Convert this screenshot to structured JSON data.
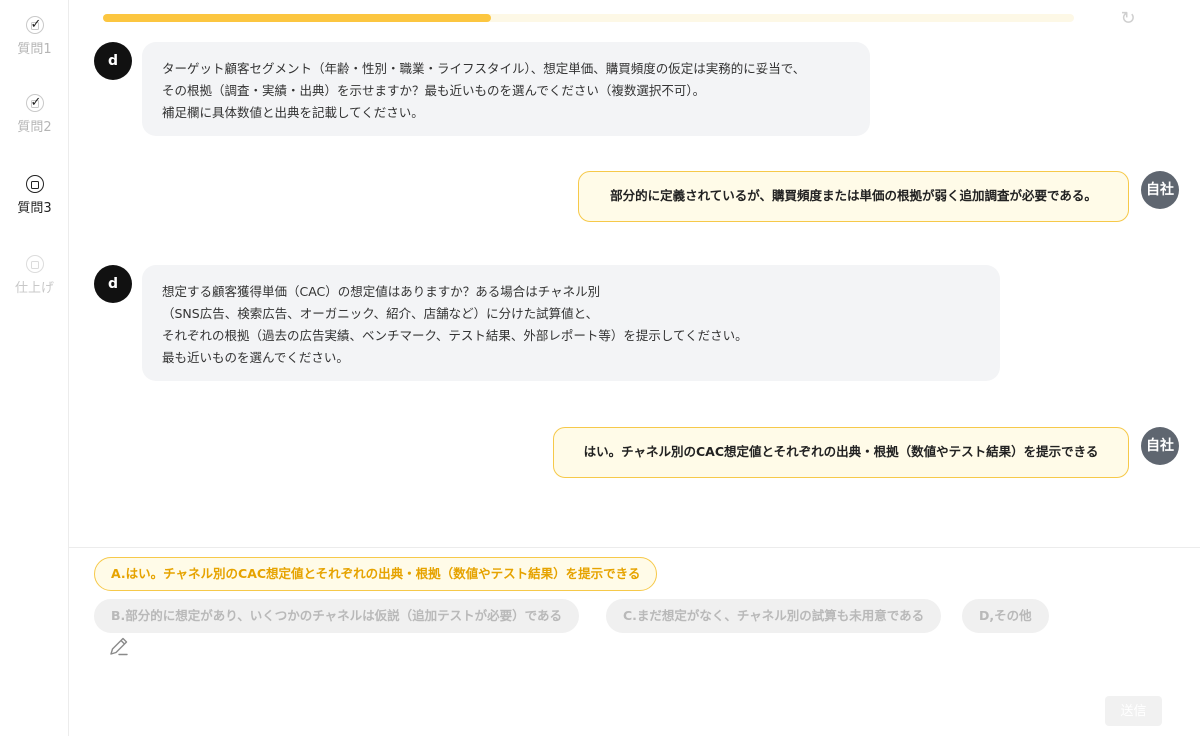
{
  "sidebar": {
    "steps": [
      {
        "label": "質問1",
        "state": "done"
      },
      {
        "label": "質問2",
        "state": "done"
      },
      {
        "label": "質問3",
        "state": "active"
      },
      {
        "label": "仕上げ",
        "state": "future"
      }
    ]
  },
  "progress": {
    "value_percent": 40
  },
  "chat": {
    "bot_avatar": "d",
    "self_avatar": "自社",
    "q1_lines": [
      "ターゲット顧客セグメント（年齢・性別・職業・ライフスタイル）、想定単価、購買頻度の仮定は実務的に妥当で、",
      "その根拠（調査・実績・出典）を示せますか？最も近いものを選んでください（複数選択不可）。",
      "補足欄に具体数値と出典を記載してください。"
    ],
    "a1": "部分的に定義されているが、購買頻度または単価の根拠が弱く追加調査が必要である。",
    "q2_lines": [
      "想定する顧客獲得単価（CAC）の想定値はありますか？ある場合はチャネル別",
      "（SNS広告、検索広告、オーガニック、紹介、店舗など）に分けた試算値と、",
      "それぞれの根拠（過去の広告実績、ベンチマーク、テスト結果、外部レポート等）を提示してください。",
      "最も近いものを選んでください。"
    ],
    "a2": "はい。チャネル別のCAC想定値とそれぞれの出典・根拠（数値やテスト結果）を提示できる"
  },
  "options": {
    "a": "A.はい。チャネル別のCAC想定値とそれぞれの出典・根拠（数値やテスト結果）を提示できる",
    "b": "B.部分的に想定があり、いくつかのチャネルは仮説（追加テストが必要）である",
    "c": "C.まだ想定がなく、チャネル別の試算も未用意である",
    "d": "D,その他"
  },
  "send_label": "送信",
  "icons": {
    "refresh": "refresh-icon",
    "pencil": "pencil-icon",
    "check": "check-icon"
  },
  "colors": {
    "accent": "#fcc640",
    "accent_text": "#e6a300",
    "answer_bg": "#fffbe8",
    "question_bg": "#f3f4f6"
  }
}
